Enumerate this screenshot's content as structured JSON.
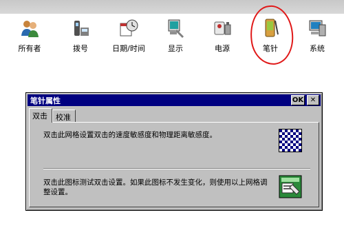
{
  "control_panel": {
    "items": [
      {
        "label": "所有者",
        "icon": "owner-icon"
      },
      {
        "label": "拨号",
        "icon": "dialing-icon"
      },
      {
        "label": "日期/时间",
        "icon": "date-time-icon"
      },
      {
        "label": "显示",
        "icon": "display-icon"
      },
      {
        "label": "电源",
        "icon": "power-icon"
      },
      {
        "label": "笔针",
        "icon": "stylus-icon"
      },
      {
        "label": "系统",
        "icon": "system-icon"
      }
    ]
  },
  "annotation": {
    "color": "#e01818"
  },
  "dialog": {
    "title": "笔针属性",
    "ok_label": "OK",
    "close_label": "✕",
    "tabs": [
      {
        "label": "双击",
        "active": true
      },
      {
        "label": "校准",
        "active": false
      }
    ],
    "double_click_text": "双击此网格设置双击的速度敏感度和物理距离敏感度。",
    "test_text": "双击此图标测试双击设置。如果此图标不发生变化，则使用以上网格调整设置。"
  },
  "colors": {
    "titlebar": "#000080",
    "dialog_bg": "#c0c0c0",
    "checker": "#00007f"
  }
}
